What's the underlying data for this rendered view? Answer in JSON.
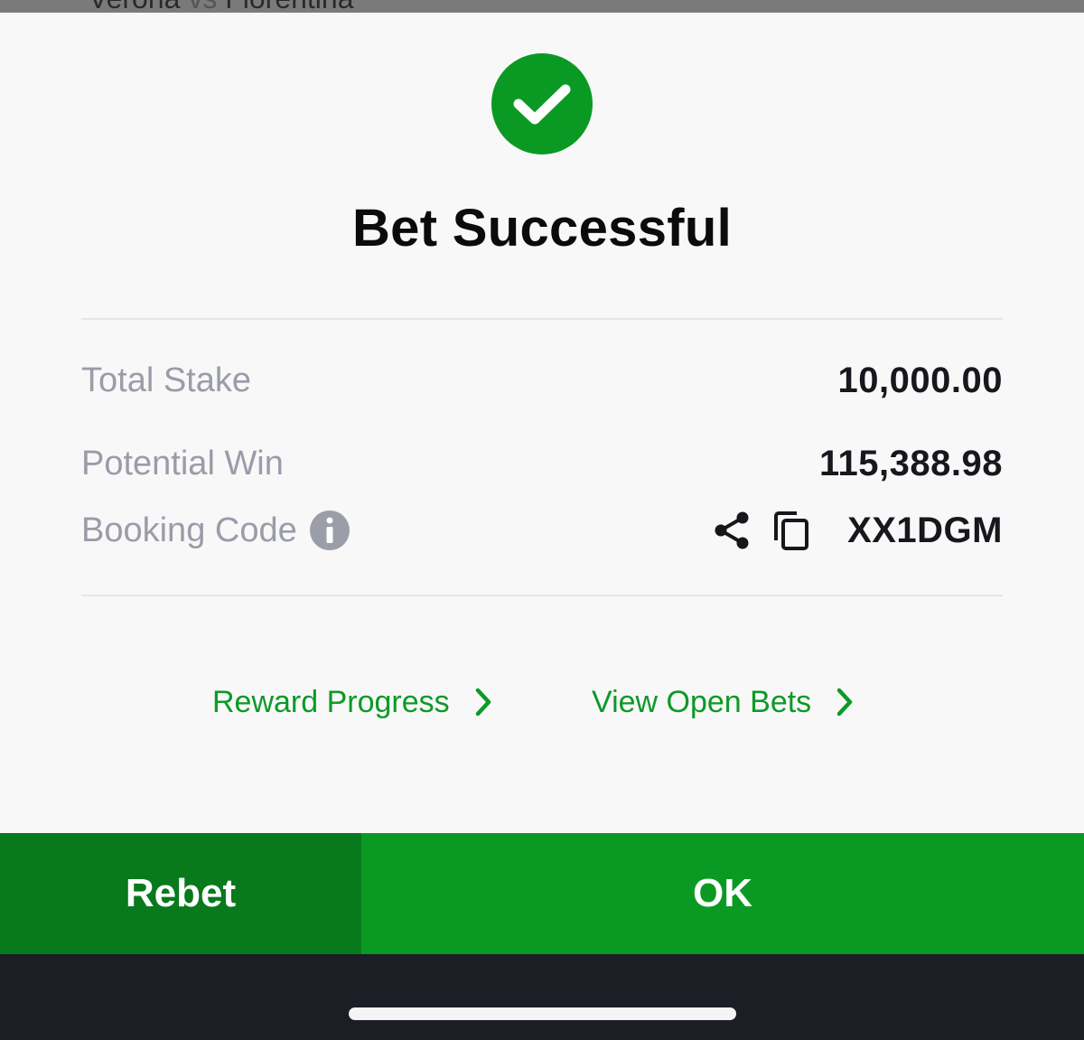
{
  "background_header": {
    "team_home": "Verona",
    "vs": "vs",
    "team_away": "Fiorentina"
  },
  "sheet": {
    "title": "Bet Successful",
    "success_icon": "check-circle-icon",
    "details": {
      "total_stake_label": "Total Stake",
      "total_stake_value": "10,000.00",
      "potential_win_label": "Potential Win",
      "potential_win_value": "115,388.98",
      "booking_code_label": "Booking Code",
      "booking_code_value": "XX1DGM"
    },
    "links": {
      "reward_progress": "Reward Progress",
      "view_open_bets": "View Open Bets"
    }
  },
  "actions": {
    "rebet_label": "Rebet",
    "ok_label": "OK"
  },
  "colors": {
    "accent_green": "#0a9a24",
    "dark_green": "#087a1c",
    "muted_label": "#9a9ca8",
    "sheet_bg": "#f8f8f8",
    "system_bar": "#1b1e25"
  }
}
